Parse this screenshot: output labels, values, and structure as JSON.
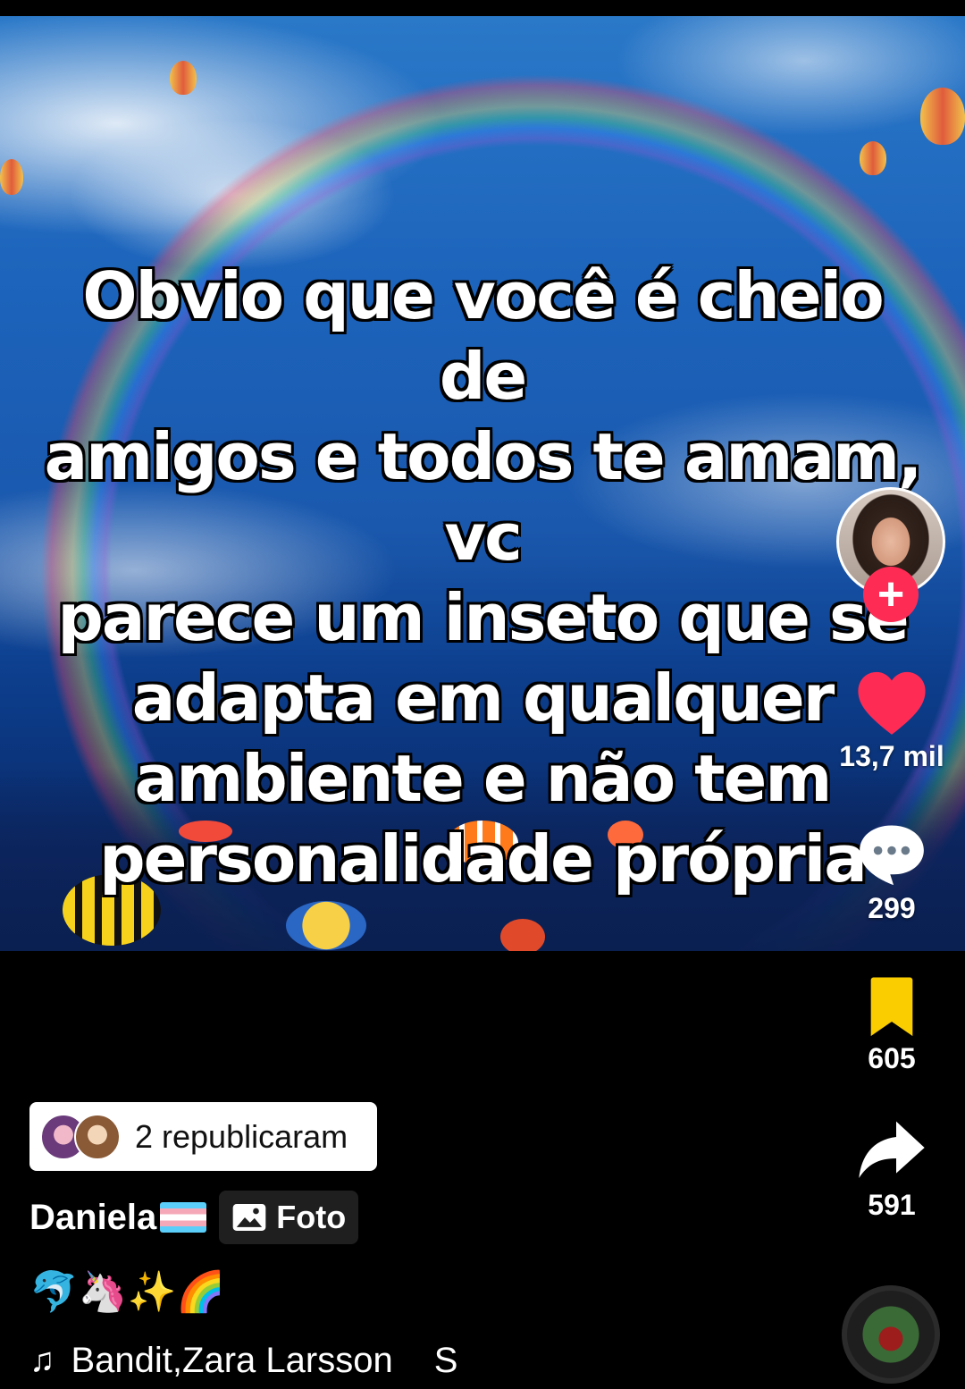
{
  "post": {
    "overlay_lines": [
      "Obvio que você é cheio de",
      "amigos e todos te amam, vc",
      "parece um inseto que se",
      "adapta em qualquer",
      "ambiente e não tem",
      "personalidade própria"
    ]
  },
  "actions": {
    "follow_label": "+",
    "likes": "13,7 mil",
    "comments": "299",
    "saves": "605",
    "shares": "591"
  },
  "colors": {
    "like": "#fe2c55",
    "follow": "#fe2c55",
    "save": "#facd00"
  },
  "info": {
    "repost_text": "2 republicaram",
    "username": "Daniela",
    "photo_badge": "Foto",
    "caption": "🐬🦄✨🌈",
    "music_note": "♫",
    "music_title": "Bandit,Zara Larsson",
    "music_extra": "S"
  }
}
